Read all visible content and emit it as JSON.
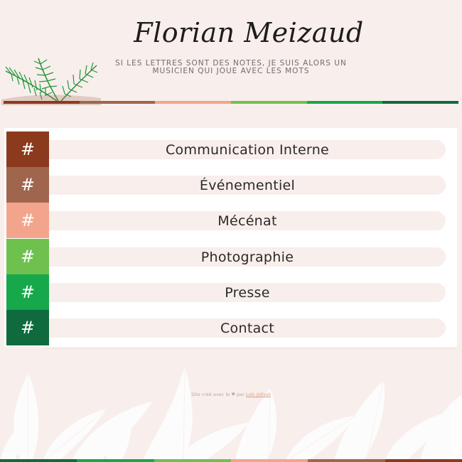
{
  "header": {
    "title": "Florian Meizaud",
    "tagline": "Si les lettres sont des notes, je suis alors un musicien qui joue avec les mots"
  },
  "stripe_colors": [
    "#8b3a1e",
    "#a0654d",
    "#f2a58c",
    "#6ec14f",
    "#16a84a",
    "#0f6b3d"
  ],
  "menu": {
    "items": [
      {
        "icon": "hash-icon",
        "symbol": "#",
        "label": "Communication Interne",
        "color": "#8b3a1e"
      },
      {
        "icon": "hash-icon",
        "symbol": "#",
        "label": "Événementiel",
        "color": "#a0654d"
      },
      {
        "icon": "hash-icon",
        "symbol": "#",
        "label": "Mécénat",
        "color": "#f2a58c"
      },
      {
        "icon": "hash-icon",
        "symbol": "#",
        "label": "Photographie",
        "color": "#6ec14f"
      },
      {
        "icon": "hash-icon",
        "symbol": "#",
        "label": "Presse",
        "color": "#16a84a"
      },
      {
        "icon": "hash-icon",
        "symbol": "#",
        "label": "Contact",
        "color": "#0f6b3d"
      }
    ]
  },
  "footer": {
    "prefix": "Site créé avec le",
    "heart": "♥",
    "by": "par",
    "author_link": "Loïc Jolivet"
  },
  "colors": {
    "background": "#f8eeeb",
    "panel": "#ffffff",
    "leaf_green": "#1f9e3b"
  }
}
